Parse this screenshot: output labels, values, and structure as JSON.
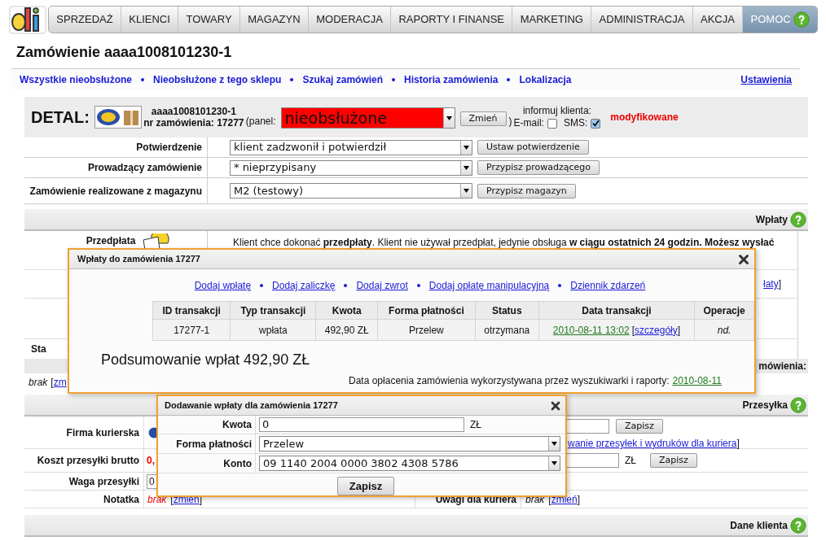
{
  "nav": {
    "items": [
      {
        "label": "SPRZEDAŻ",
        "selected": false
      },
      {
        "label": "KLIENCI",
        "selected": false
      },
      {
        "label": "TOWARY",
        "selected": false
      },
      {
        "label": "MAGAZYN",
        "selected": false
      },
      {
        "label": "MODERACJA",
        "selected": false
      },
      {
        "label": "RAPORTY I FINANSE",
        "selected": false
      },
      {
        "label": "MARKETING",
        "selected": false
      },
      {
        "label": "ADMINISTRACJA",
        "selected": false
      },
      {
        "label": "AKCJA",
        "selected": false
      },
      {
        "label": "POMOC",
        "selected": true
      }
    ]
  },
  "title": "Zamówienie aaaa1008101230-1",
  "links": [
    "Wszystkie nieobsłużone",
    "Nieobsłużone z tego sklepu",
    "Szukaj zamówień",
    "Historia zamówienia",
    "Lokalizacja"
  ],
  "settings_link": "Ustawienia",
  "detail": {
    "label": "DETAL:",
    "order_code": "aaaa1008101230-1",
    "order_number": "nr zamówienia: 17277",
    "panel_open": "(panel:",
    "panel_value": "nieobsłużone",
    "change_button": "Zmień",
    "panel_close": ")",
    "notify_label": "informuj klienta:",
    "email_label": "E-mail:",
    "email_checked": false,
    "sms_label": "SMS:",
    "sms_checked": true,
    "status": "modyfikowane"
  },
  "settings_rows": [
    {
      "label": "Potwierdzenie",
      "value": "klient zadzwonił i potwierdził",
      "button": "Ustaw potwierdzenie"
    },
    {
      "label": "Prowadzący zamówienie",
      "value": "* nieprzypisany",
      "button": "Przypisz prowadzącego"
    },
    {
      "label": "Zamówienie realizowane z magazynu",
      "value": "M2 (testowy)",
      "button": "Przypisz magazyn"
    }
  ],
  "payments_section": {
    "title": "Wpłaty",
    "prepayment_label": "Przedpłata",
    "prepayment_text": "Klient chce dokonać **przedpłaty**. Klient nie używał przedpłat, jedynie obsługa **w ciągu ostatnich 24 godzin. Możesz wysłać**",
    "link_fragment": "łaty",
    "link_close": "]",
    "row_label_fragment": "Sta",
    "footer_fragment": "mówienia:",
    "note_value": "brak",
    "note_open": "[",
    "note_link_fragment": "zm"
  },
  "shipping_section": {
    "title": "Przesyłka",
    "courier_label": "Firma kurierska",
    "save_button": "Zapisz",
    "courier_link_fragment": "wanie przesyłek i wydruków dla kuriera",
    "courier_link_close": "]",
    "cost_label": "Koszt przesyłki brutto",
    "cost_value": "0,",
    "cost_currency": "ZŁ",
    "cost_button": "Zapisz",
    "weight_label": "Waga przesyłki",
    "weight_value": "0",
    "note_label": "Notatka",
    "note_value": "brak",
    "note_open": "[",
    "note_link": "zmień",
    "note_close": "]",
    "courier_notes_label": "Uwagi dla kuriera",
    "courier_notes_value": "brak",
    "courier_notes_open": "[",
    "courier_notes_link": "zmień",
    "courier_notes_close": "]"
  },
  "customer_section": {
    "title": "Dane klienta"
  },
  "payments_dialog": {
    "title": "Wpłaty do zamówienia 17277",
    "actions": [
      "Dodaj wpłatę",
      "Dodaj zaliczkę",
      "Dodaj zwrot",
      "Dodaj opłatę manipulacyjną",
      "Dziennik zdarzeń"
    ],
    "table": {
      "columns": [
        "ID transakcji",
        "Typ transakcji",
        "Kwota",
        "Forma płatności",
        "Status",
        "Data transakcji",
        "Operacje"
      ],
      "rows": [
        {
          "id": "17277-1",
          "type": "wpłata",
          "amount": "492,90 ZŁ",
          "method": "Przelew",
          "status": "otrzymana",
          "date": "2010-08-11 13:02",
          "details_open": "[",
          "details_link": "szczegóły",
          "details_close": "]",
          "operations": "nd."
        }
      ]
    },
    "summary": "Podsumowanie wpłat 492,90 ZŁ",
    "payment_date_note": "Data opłacenia zamówienia wykorzystywana przez wyszukiwarki i raporty:",
    "payment_date": "2010-08-11"
  },
  "add_payment_dialog": {
    "title": "Dodawanie wpłaty dla zamówienia 17277",
    "amount_label": "Kwota",
    "amount_value": "0",
    "amount_currency": "ZŁ",
    "method_label": "Forma płatności",
    "method_value": "Przelew",
    "account_label": "Konto",
    "account_value": "09 1140 2004 0000 3802 4308 5786",
    "submit": "Zapisz"
  }
}
